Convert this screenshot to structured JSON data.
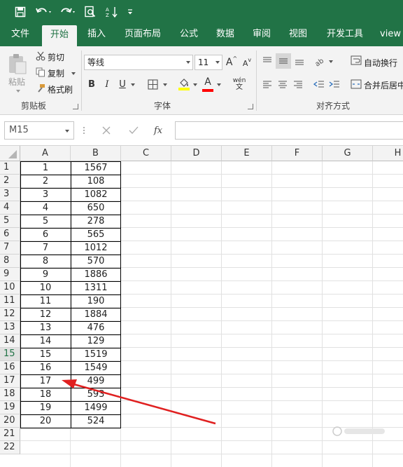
{
  "quick_access": {
    "save_icon": "save-icon",
    "undo_icon": "undo-icon",
    "redo_icon": "redo-icon",
    "print_preview_icon": "print-preview-icon",
    "sort_icon": "sort-ascending-icon",
    "customize_icon": "customize-quick-access-icon"
  },
  "tabs": [
    {
      "label": "文件"
    },
    {
      "label": "开始",
      "active": true
    },
    {
      "label": "插入"
    },
    {
      "label": "页面布局"
    },
    {
      "label": "公式"
    },
    {
      "label": "数据"
    },
    {
      "label": "审阅"
    },
    {
      "label": "视图"
    },
    {
      "label": "开发工具"
    },
    {
      "label": "view"
    }
  ],
  "clipboard": {
    "paste": "粘贴",
    "cut": "剪切",
    "copy": "复制",
    "format_painter": "格式刷",
    "group_label": "剪贴板"
  },
  "font": {
    "font_name": "等线",
    "font_size": "11",
    "bold": "B",
    "italic": "I",
    "underline": "U",
    "grow": "A",
    "shrink": "A",
    "phonetic": "wén",
    "font_color_label": "A",
    "fill_color": "#ffff00",
    "font_color": "#ff0000",
    "group_label": "字体"
  },
  "alignment": {
    "wrap_text": "自动换行",
    "merge_center": "合并后居中",
    "group_label": "对齐方式"
  },
  "formula_bar": {
    "name_box": "M15",
    "fx": "fx",
    "formula": ""
  },
  "columns": [
    "A",
    "B",
    "C",
    "D",
    "E",
    "F",
    "G",
    "H"
  ],
  "rows": [
    "1",
    "2",
    "3",
    "4",
    "5",
    "6",
    "7",
    "8",
    "9",
    "10",
    "11",
    "12",
    "13",
    "14",
    "15",
    "16",
    "17",
    "18",
    "19",
    "20",
    "21",
    "22"
  ],
  "selected_row": "15",
  "sheet_data": [
    {
      "a": "1",
      "b": "1567"
    },
    {
      "a": "2",
      "b": "108"
    },
    {
      "a": "3",
      "b": "1082"
    },
    {
      "a": "4",
      "b": "650"
    },
    {
      "a": "5",
      "b": "278"
    },
    {
      "a": "6",
      "b": "565"
    },
    {
      "a": "7",
      "b": "1012"
    },
    {
      "a": "8",
      "b": "570"
    },
    {
      "a": "9",
      "b": "1886"
    },
    {
      "a": "10",
      "b": "1311"
    },
    {
      "a": "11",
      "b": "190"
    },
    {
      "a": "12",
      "b": "1884"
    },
    {
      "a": "13",
      "b": "476"
    },
    {
      "a": "14",
      "b": "129"
    },
    {
      "a": "15",
      "b": "1519"
    },
    {
      "a": "16",
      "b": "1549"
    },
    {
      "a": "17",
      "b": "499"
    },
    {
      "a": "18",
      "b": "593"
    },
    {
      "a": "19",
      "b": "1499"
    },
    {
      "a": "20",
      "b": "524"
    }
  ],
  "annotation_color": "#e02020",
  "colors": {
    "excel_green": "#217346"
  }
}
